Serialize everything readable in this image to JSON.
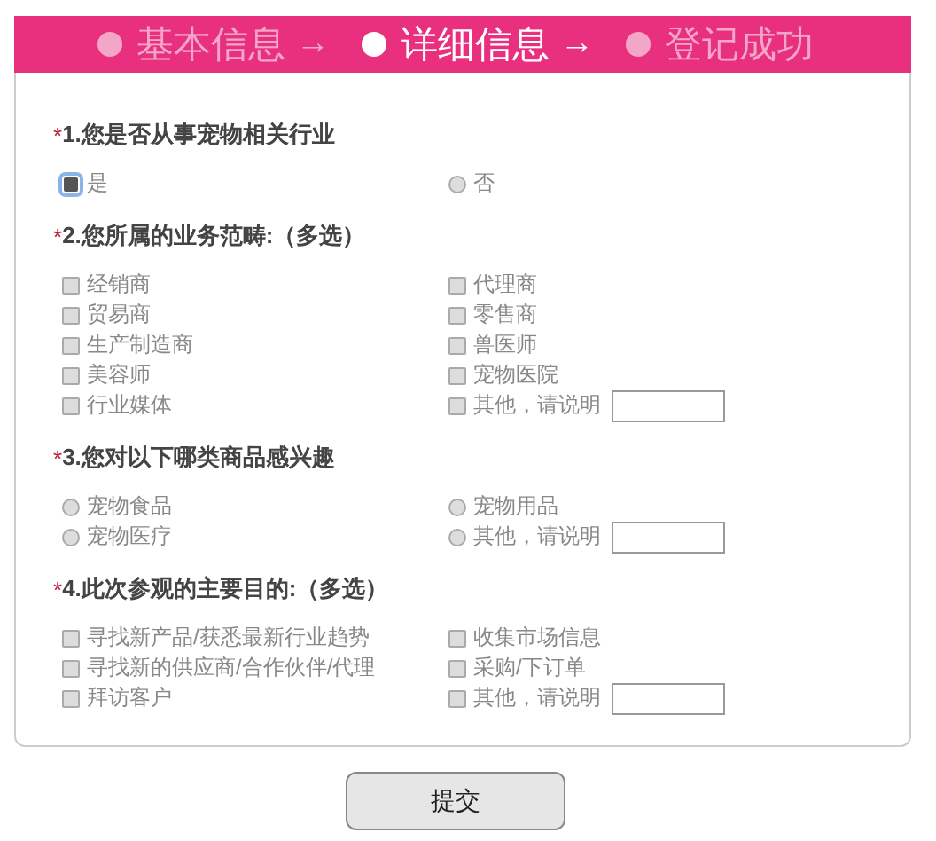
{
  "steps": [
    {
      "label": "基本信息",
      "arrow": "→",
      "selected": false
    },
    {
      "label": "详细信息",
      "arrow": "→",
      "selected": true
    },
    {
      "label": "登记成功",
      "selected": false
    }
  ],
  "questions": [
    {
      "mark": "*",
      "title": "1.您是否从事宠物相关行业",
      "kind": "radio",
      "options": [
        {
          "label": "是",
          "selected": true,
          "kind": "plain"
        },
        {
          "label": "否",
          "selected": false,
          "kind": "plain"
        }
      ]
    },
    {
      "mark": "*",
      "title": "2.您所属的业务范畴:（多选）",
      "kind": "checkbox",
      "options": [
        {
          "label": "经销商",
          "checked": false,
          "kind": "plain"
        },
        {
          "label": "代理商",
          "checked": false,
          "kind": "plain"
        },
        {
          "label": "贸易商",
          "checked": false,
          "kind": "plain"
        },
        {
          "label": "零售商",
          "checked": false,
          "kind": "plain"
        },
        {
          "label": "生产制造商",
          "checked": false,
          "kind": "plain"
        },
        {
          "label": "兽医师",
          "checked": false,
          "kind": "plain"
        },
        {
          "label": "美容师",
          "checked": false,
          "kind": "plain"
        },
        {
          "label": "宠物医院",
          "checked": false,
          "kind": "plain"
        },
        {
          "label": "行业媒体",
          "checked": false,
          "kind": "plain"
        },
        {
          "label": "其他，请说明",
          "checked": false,
          "kind": "other"
        }
      ]
    },
    {
      "mark": "*",
      "title": "3.您对以下哪类商品感兴趣",
      "kind": "radio",
      "options": [
        {
          "label": "宠物食品",
          "selected": false,
          "kind": "plain"
        },
        {
          "label": "宠物用品",
          "selected": false,
          "kind": "plain"
        },
        {
          "label": "宠物医疗",
          "selected": false,
          "kind": "plain"
        },
        {
          "label": "其他，请说明",
          "selected": false,
          "kind": "other"
        }
      ]
    },
    {
      "mark": "*",
      "title": "4.此次参观的主要目的:（多选）",
      "kind": "checkbox",
      "options": [
        {
          "label": "寻找新产品/获悉最新行业趋势",
          "checked": false,
          "kind": "plain"
        },
        {
          "label": "收集市场信息",
          "checked": false,
          "kind": "plain"
        },
        {
          "label": "寻找新的供应商/合作伙伴/代理",
          "checked": false,
          "kind": "plain"
        },
        {
          "label": "采购/下订单",
          "checked": false,
          "kind": "plain"
        },
        {
          "label": "拜访客户",
          "checked": false,
          "kind": "plain"
        },
        {
          "label": "其他，请说明",
          "checked": false,
          "kind": "other"
        }
      ]
    }
  ],
  "submit": "提交"
}
